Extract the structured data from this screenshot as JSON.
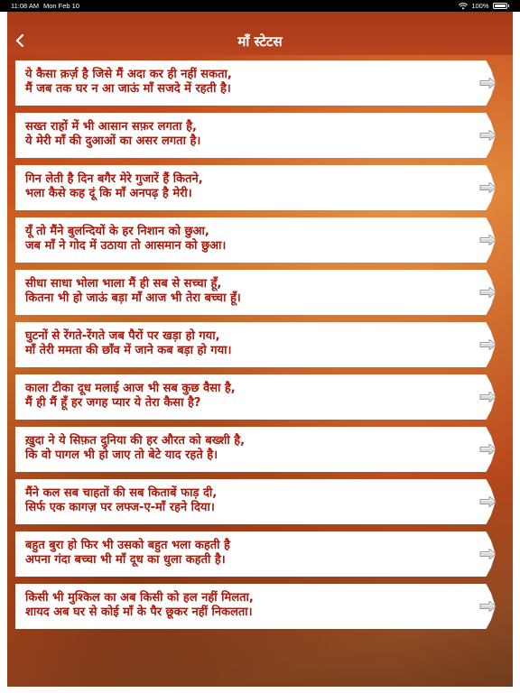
{
  "status_bar": {
    "time": "11:08 AM",
    "date": "Mon Feb 10",
    "battery": "100%"
  },
  "header": {
    "title": "माँ स्टेटस",
    "back_icon": "chevron-left-icon"
  },
  "statuses": [
    {
      "line1": "ये कैसा क़र्ज़ है जिसे मैं अदा कर ही नहीं सकता,",
      "line2": "मैं जब तक घर न आ जाऊं माँ सजदे में रहती है।"
    },
    {
      "line1": "सख्त राहों में भी आसान सफ़र लगता है,",
      "line2": "ये मेरी माँ की दुआओं का असर लगता है।"
    },
    {
      "line1": "गिन लेती है दिन बगैर मेरे गुजारें हैं कितने,",
      "line2": "भला कैसे कह दूं कि माँ अनपढ़ है मेरी।"
    },
    {
      "line1": "यूँ तो मैंने बुलन्दियों के हर निशान को छुआ,",
      "line2": "जब माँ ने गोद में उठाया तो आसमान को छुआ।"
    },
    {
      "line1": "सीधा साधा भोला भाला मैं ही सब से सच्चा हूँ,",
      "line2": "कितना भी हो जाऊं बड़ा माँ आज भी तेरा बच्चा हूँ।"
    },
    {
      "line1": "घुटनों से रेंगते-रेंगते जब पैरों पर खड़ा हो गया,",
      "line2": "माँ तेरी ममता की छाँव में जाने कब बड़ा हो गया।"
    },
    {
      "line1": "काला टीका दूध मलाई आज भी सब कुछ वैसा है,",
      "line2": "मैं ही मैं हूँ हर जगह प्यार ये तेरा कैसा है?"
    },
    {
      "line1": "ख़ुदा ने ये सिफ़त दुनिया की हर औरत को बख्शी है,",
      "line2": "कि वो पागल भी हो जाए तो बेटे याद रहते है।"
    },
    {
      "line1": "मैंने कल सब चाहतों की सब किताबें फाड़ दी,",
      "line2": "सिर्फ एक कागज़ पर लफ्ज-ए-माँ रहने दिया।"
    },
    {
      "line1": "बहुत बुरा हो फिर भी उसको बहुत भला कहती है",
      "line2": "अपना गंदा बच्चा भी माँ दूध का धुला कहती है।"
    },
    {
      "line1": "किसी भी मुश्किल का अब किसी को हल नहीं मिलता,",
      "line2": "शायद अब घर से कोई माँ के पैर छूकर नहीं निकलता।"
    }
  ],
  "row_icon": "arrow-right-icon",
  "colors": {
    "text": "#a21c10",
    "header": "#a6391a",
    "background_top": "#b13a16",
    "background_mid": "#d9782e"
  }
}
